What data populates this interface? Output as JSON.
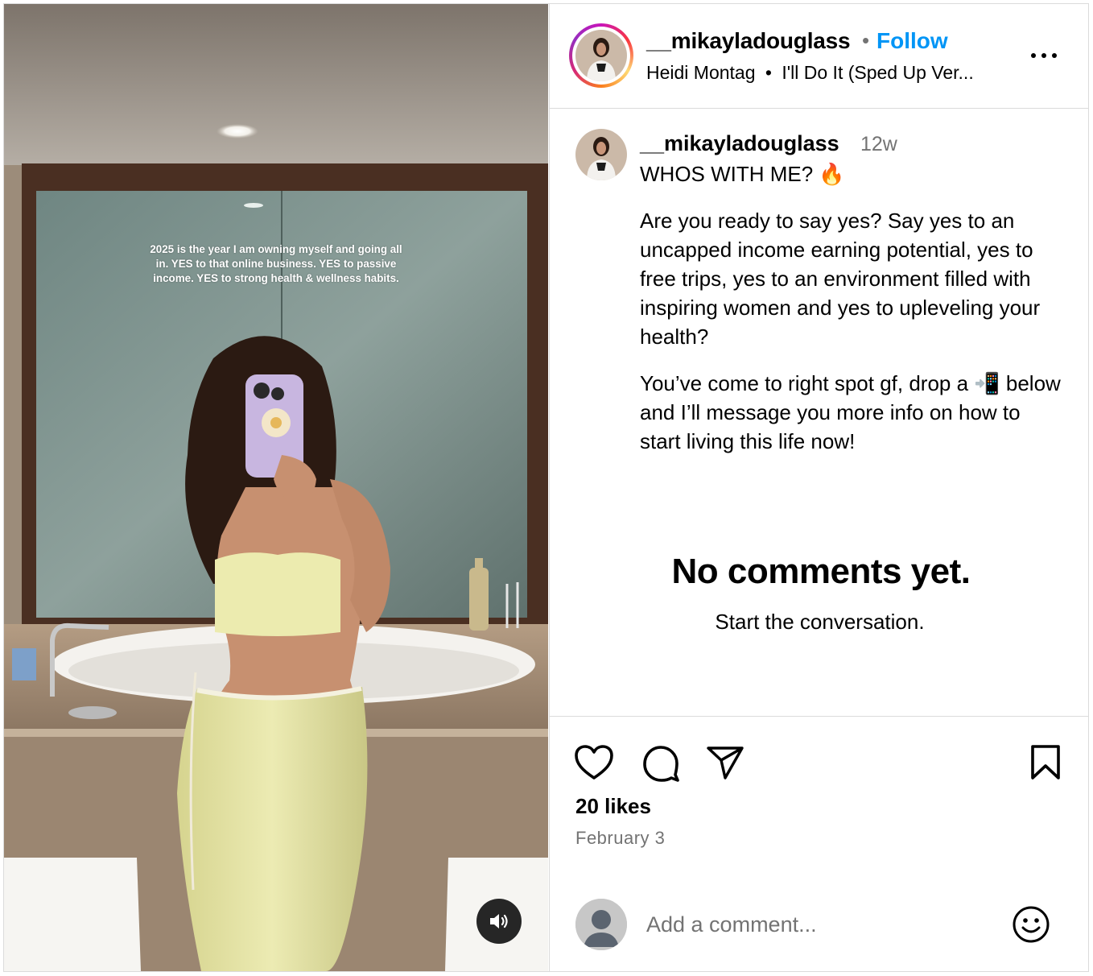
{
  "post": {
    "media": {
      "overlay_text": "2025 is the year I am owning myself and going all in. YES to that online business. YES to passive income. YES to strong health & wellness habits.",
      "audio_icon": "speaker-icon"
    },
    "header": {
      "username": "__mikayladouglass",
      "separator": "•",
      "follow_label": "Follow",
      "audio_artist": "Heidi Montag",
      "audio_separator": "•",
      "audio_track": "I'll Do It (Sped Up Ver...",
      "more_icon": "more-options-icon"
    },
    "caption": {
      "username": "__mikayladouglass",
      "time_ago": "12w",
      "lines": [
        "WHOS WITH ME? 🔥",
        "Are you ready to say yes? Say yes to an uncapped income earning potential, yes to free trips, yes to an environment filled with inspiring women and yes to upleveling your health?",
        "You’ve come to right spot gf, drop a 📲 below and I’ll message you more info on how to start living this life now!"
      ]
    },
    "comments": {
      "empty_title": "No comments yet.",
      "empty_subtitle": "Start the conversation."
    },
    "actions": {
      "like_icon": "heart-icon",
      "comment_icon": "comment-icon",
      "share_icon": "send-icon",
      "save_icon": "bookmark-icon",
      "likes_text": "20 likes",
      "date": "February 3"
    },
    "add_comment": {
      "placeholder": "Add a comment...",
      "emoji_icon": "emoji-icon"
    }
  },
  "colors": {
    "accent": "#0095f6",
    "secondary_text": "#737373",
    "border": "#dbdbdb",
    "audio_button": "#262626"
  }
}
